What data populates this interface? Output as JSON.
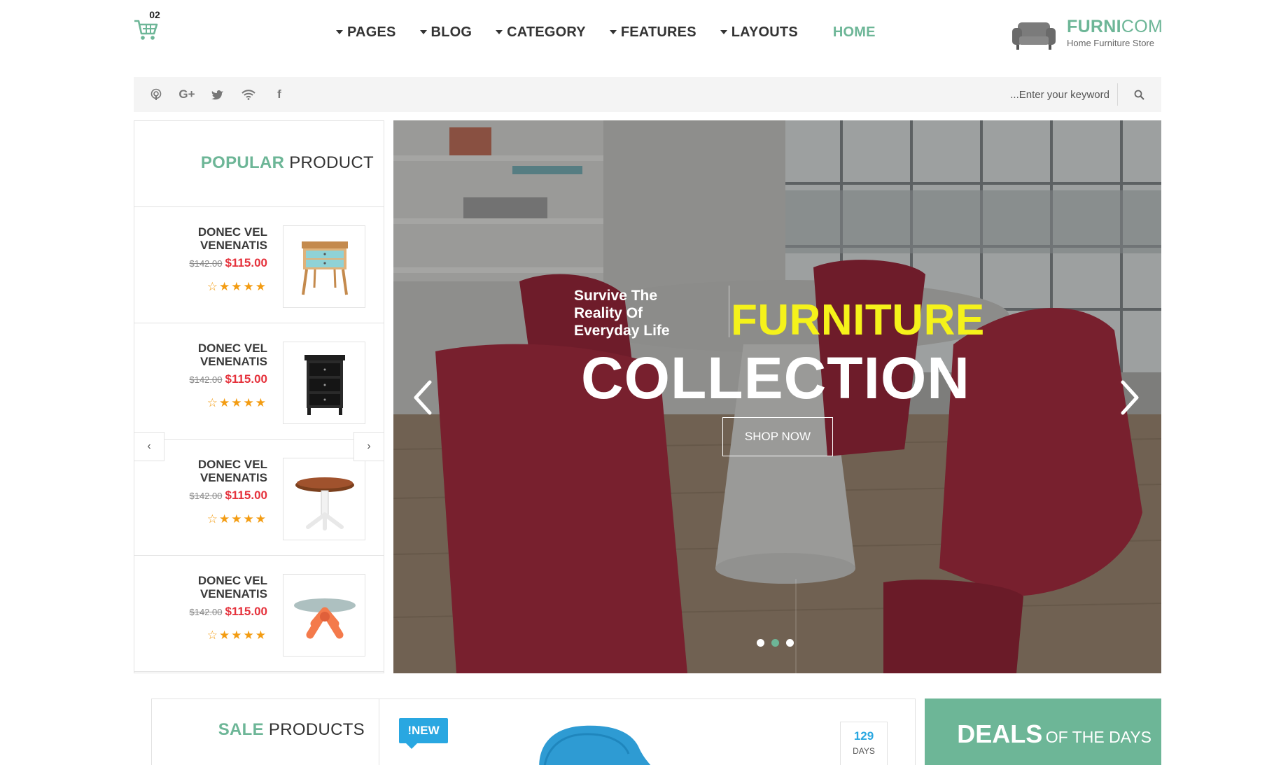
{
  "header": {
    "cart_count": "02",
    "nav": [
      {
        "label": "PAGES"
      },
      {
        "label": "BLOG"
      },
      {
        "label": "CATEGORY"
      },
      {
        "label": "FEATURES"
      },
      {
        "label": "LAYOUTS"
      }
    ],
    "home_label": "HOME",
    "logo": {
      "name_bold": "FURNI",
      "name_light": "COM",
      "tagline": "Home Furniture Store"
    }
  },
  "bar": {
    "social_icons": [
      "podcast-icon",
      "google-plus-icon",
      "twitter-icon",
      "wifi-icon",
      "facebook-icon"
    ],
    "google_plus_text": "G+",
    "facebook_text": "f",
    "search": {
      "placeholder": "...Enter your keyword"
    }
  },
  "popular": {
    "title_highlight": "POPULAR",
    "title_rest": "PRODUCT",
    "prev_label": "‹",
    "next_label": "›",
    "products": [
      {
        "name": "DONEC VEL VENENATIS",
        "old_price": "$142.00",
        "price": "$115.00",
        "stars": "☆★★★★",
        "image": "nightstand-teal"
      },
      {
        "name": "DONEC VEL VENENATIS",
        "old_price": "$142.00",
        "price": "$115.00",
        "stars": "☆★★★★",
        "image": "chest-black"
      },
      {
        "name": "DONEC VEL VENENATIS",
        "old_price": "$142.00",
        "price": "$115.00",
        "stars": "☆★★★★",
        "image": "round-table"
      },
      {
        "name": "DONEC VEL VENENATIS",
        "old_price": "$142.00",
        "price": "$115.00",
        "stars": "☆★★★★",
        "image": "glass-table-orange"
      }
    ]
  },
  "hero": {
    "tagline_1": "Survive The",
    "tagline_2": "Reality Of",
    "tagline_3": "Everyday Life",
    "title_1": "FURNITURE",
    "title_2": "COLLECTION",
    "button": "SHOP NOW",
    "slides": 3,
    "active_slide": 2
  },
  "sale": {
    "title_highlight": "SALE",
    "title_rest": "PRODUCTS"
  },
  "feature": {
    "badge": "!NEW",
    "countdown_value": "129",
    "countdown_label": "DAYS"
  },
  "deals": {
    "title_bold": "DEALS",
    "title_rest": "OF THE DAYS"
  },
  "colors": {
    "accent": "#6db697",
    "price": "#e5323c",
    "star": "#f39c12",
    "hero_title": "#f5f21a",
    "badge": "#29a7e1"
  }
}
